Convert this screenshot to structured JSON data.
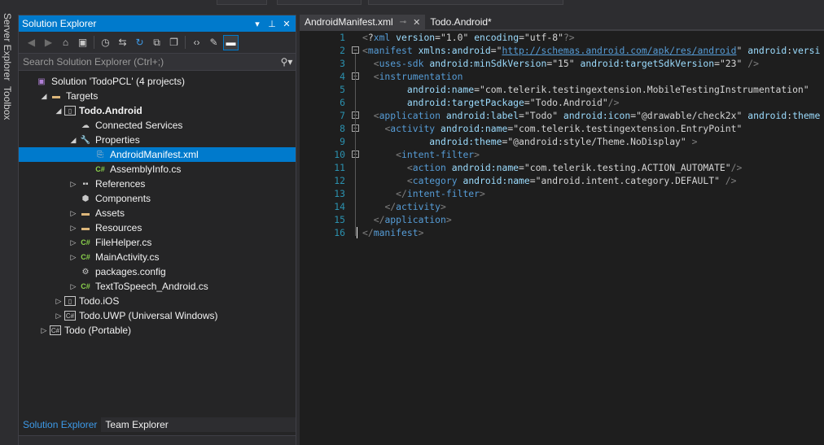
{
  "vertical_tabs": [
    "Server Explorer",
    "Toolbox"
  ],
  "solution_explorer": {
    "title": "Solution Explorer",
    "title_buttons": {
      "dropdown": "▾",
      "pin": "⊥",
      "close": "✕"
    },
    "search_placeholder": "Search Solution Explorer (Ctrl+;)",
    "tree": [
      {
        "label": "Solution 'TodoPCL' (4 projects)",
        "icon": "solution-icon",
        "indent": 0,
        "arrow": ""
      },
      {
        "label": "Targets",
        "icon": "folder-icon",
        "indent": 1,
        "arrow": "◢"
      },
      {
        "label": "Todo.Android",
        "icon": "android-project-icon",
        "indent": 2,
        "arrow": "◢",
        "bold": true
      },
      {
        "label": "Connected Services",
        "icon": "cloud-icon",
        "indent": 3,
        "arrow": ""
      },
      {
        "label": "Properties",
        "icon": "wrench-icon",
        "indent": 3,
        "arrow": "◢"
      },
      {
        "label": "AndroidManifest.xml",
        "icon": "xml-file-icon",
        "indent": 4,
        "arrow": "",
        "selected": true
      },
      {
        "label": "AssemblyInfo.cs",
        "icon": "csharp-file-icon",
        "indent": 4,
        "arrow": ""
      },
      {
        "label": "References",
        "icon": "references-icon",
        "indent": 3,
        "arrow": "▷"
      },
      {
        "label": "Components",
        "icon": "components-icon",
        "indent": 3,
        "arrow": ""
      },
      {
        "label": "Assets",
        "icon": "folder-icon",
        "indent": 3,
        "arrow": "▷"
      },
      {
        "label": "Resources",
        "icon": "folder-icon",
        "indent": 3,
        "arrow": "▷"
      },
      {
        "label": "FileHelper.cs",
        "icon": "csharp-file-icon",
        "indent": 3,
        "arrow": "▷"
      },
      {
        "label": "MainActivity.cs",
        "icon": "csharp-file-icon",
        "indent": 3,
        "arrow": "▷"
      },
      {
        "label": "packages.config",
        "icon": "config-file-icon",
        "indent": 3,
        "arrow": ""
      },
      {
        "label": "TextToSpeech_Android.cs",
        "icon": "csharp-file-icon",
        "indent": 3,
        "arrow": "▷"
      },
      {
        "label": "Todo.iOS",
        "icon": "ios-project-icon",
        "indent": 2,
        "arrow": "▷"
      },
      {
        "label": "Todo.UWP (Universal Windows)",
        "icon": "csharp-project-icon",
        "indent": 2,
        "arrow": "▷"
      },
      {
        "label": "Todo (Portable)",
        "icon": "csharp-project-icon",
        "indent": 1,
        "arrow": "▷"
      }
    ],
    "bottom_tabs": [
      "Solution Explorer",
      "Team Explorer"
    ]
  },
  "editor": {
    "tabs": [
      {
        "label": "AndroidManifest.xml",
        "active": true
      },
      {
        "label": "Todo.Android*",
        "active": false
      }
    ],
    "lines": [
      "<?xml version=\"1.0\" encoding=\"utf-8\"?>",
      "<manifest xmlns:android=\"http://schemas.android.com/apk/res/android\" android:versi",
      "  <uses-sdk android:minSdkVersion=\"15\" android:targetSdkVersion=\"23\" />",
      "  <instrumentation",
      "        android:name=\"com.telerik.testingextension.MobileTestingInstrumentation\"",
      "        android:targetPackage=\"Todo.Android\"/>",
      "  <application android:label=\"Todo\" android:icon=\"@drawable/check2x\" android:theme",
      "    <activity android:name=\"com.telerik.testingextension.EntryPoint\"",
      "            android:theme=\"@android:style/Theme.NoDisplay\" >",
      "      <intent-filter>",
      "        <action android:name=\"com.telerik.testing.ACTION_AUTOMATE\"/>",
      "        <category android:name=\"android.intent.category.DEFAULT\" />",
      "      </intent-filter>",
      "    </activity>",
      "  </application>",
      "</manifest>"
    ]
  },
  "colors": {
    "accent": "#007acc",
    "background": "#1e1e1e",
    "panel": "#252526",
    "line_numbers": "#2b91af"
  }
}
